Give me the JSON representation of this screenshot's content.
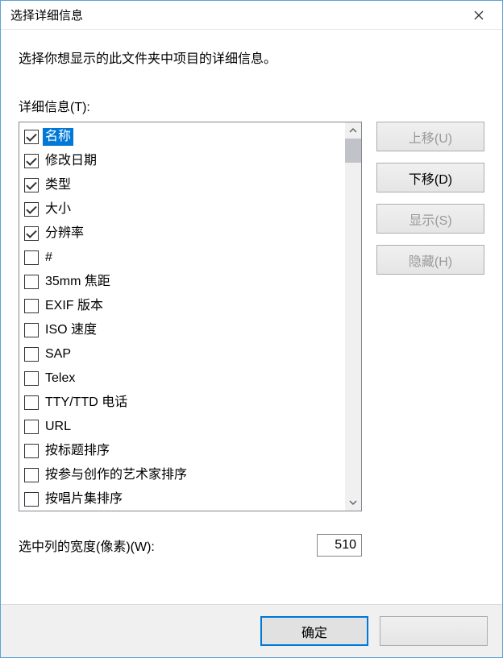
{
  "titlebar": {
    "title": "选择详细信息"
  },
  "instruction": "选择你想显示的此文件夹中项目的详细信息。",
  "section_label": "详细信息(T):",
  "list": [
    {
      "label": "名称",
      "checked": true,
      "selected": true
    },
    {
      "label": "修改日期",
      "checked": true,
      "selected": false
    },
    {
      "label": "类型",
      "checked": true,
      "selected": false
    },
    {
      "label": "大小",
      "checked": true,
      "selected": false
    },
    {
      "label": "分辨率",
      "checked": true,
      "selected": false
    },
    {
      "label": "#",
      "checked": false,
      "selected": false
    },
    {
      "label": "35mm 焦距",
      "checked": false,
      "selected": false
    },
    {
      "label": "EXIF 版本",
      "checked": false,
      "selected": false
    },
    {
      "label": "ISO 速度",
      "checked": false,
      "selected": false
    },
    {
      "label": "SAP",
      "checked": false,
      "selected": false
    },
    {
      "label": "Telex",
      "checked": false,
      "selected": false
    },
    {
      "label": "TTY/TTD 电话",
      "checked": false,
      "selected": false
    },
    {
      "label": "URL",
      "checked": false,
      "selected": false
    },
    {
      "label": "按标题排序",
      "checked": false,
      "selected": false
    },
    {
      "label": "按参与创作的艺术家排序",
      "checked": false,
      "selected": false
    },
    {
      "label": "按唱片集排序",
      "checked": false,
      "selected": false
    }
  ],
  "buttons": {
    "move_up": "上移(U)",
    "move_down": "下移(D)",
    "show": "显示(S)",
    "hide": "隐藏(H)"
  },
  "width_row": {
    "label": "选中列的宽度(像素)(W):",
    "value": "510"
  },
  "footer": {
    "ok": "确定",
    "cancel": ""
  }
}
